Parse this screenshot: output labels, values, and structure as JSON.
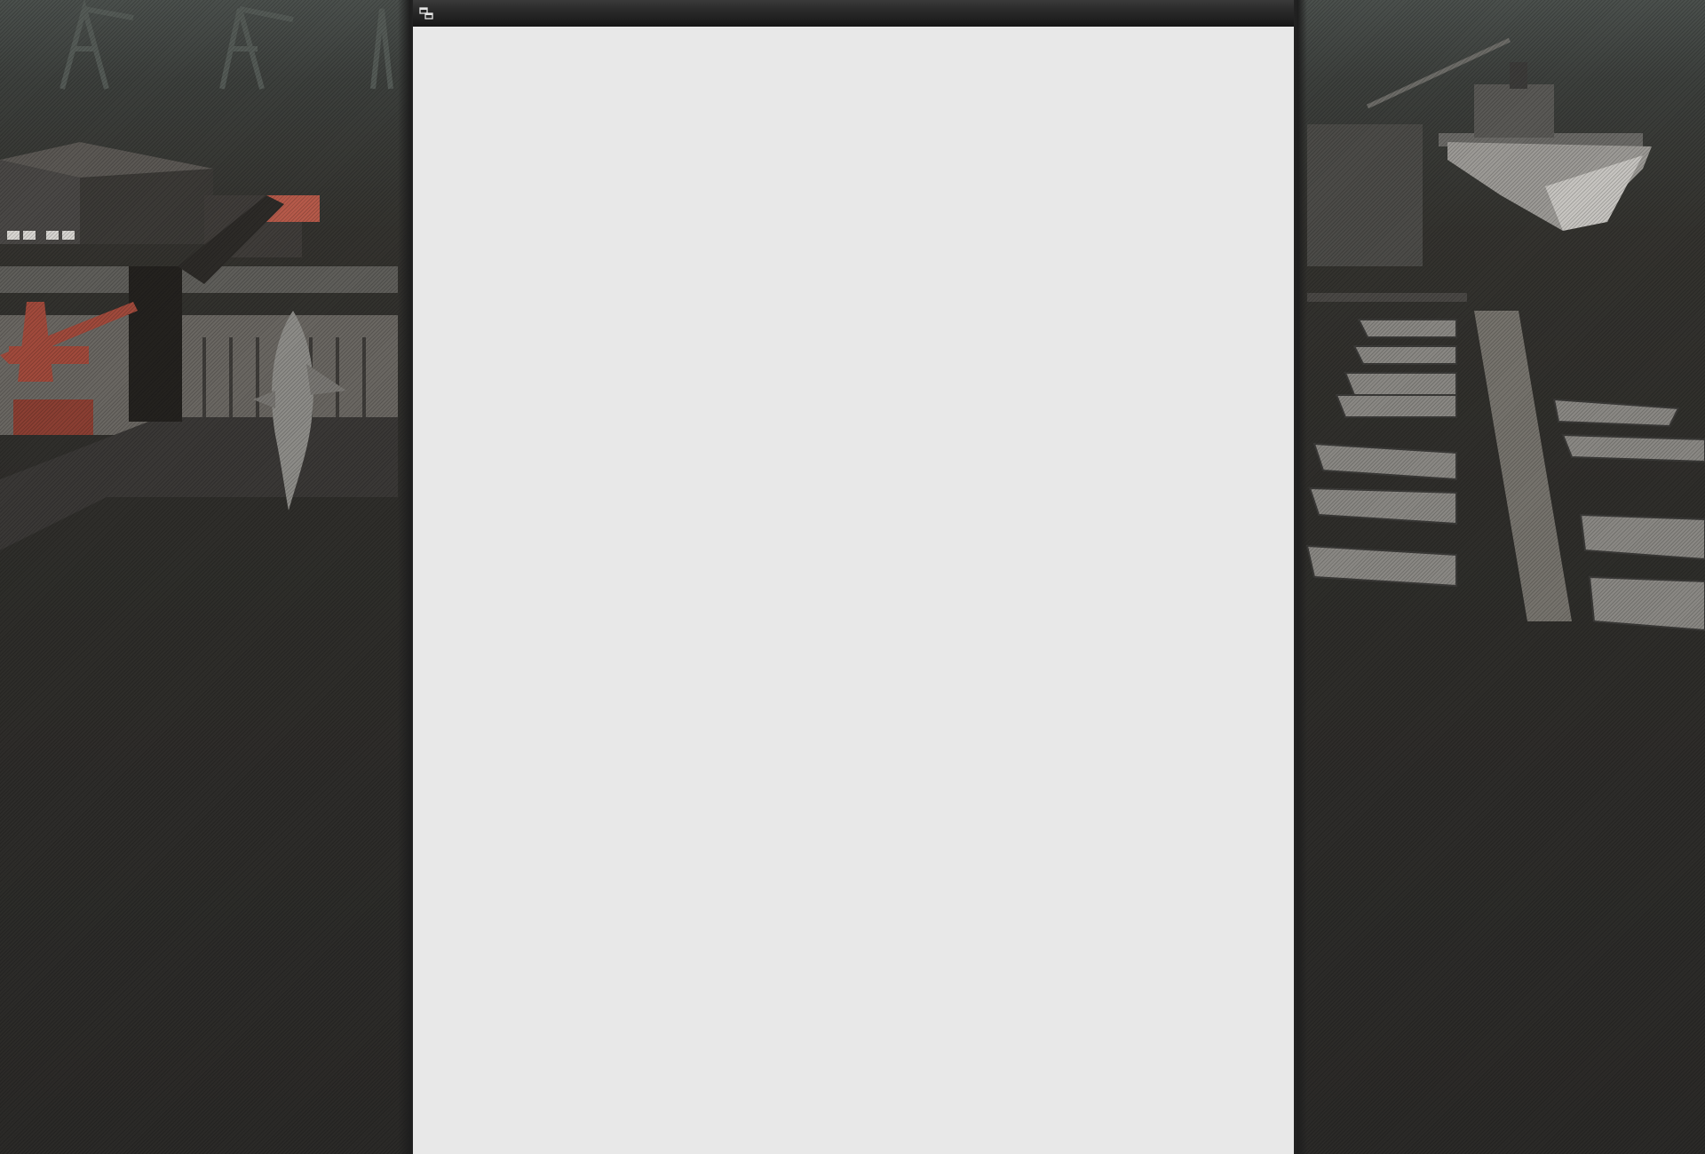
{
  "window": {
    "title": "",
    "icon": "restore-window-icon"
  },
  "content": {
    "body_text": ""
  },
  "colors": {
    "page_background": "#e8e8e8",
    "top_bar": "#1f1f1f",
    "scene_background": "#2a2a29",
    "crane_accent": "#a14a3c"
  }
}
